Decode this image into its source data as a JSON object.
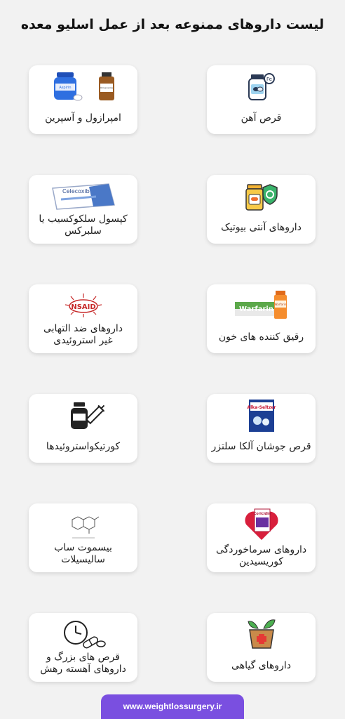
{
  "title": "لیست داروهای ممنوعه بعد از عمل اسلیو معده",
  "cards": [
    {
      "label": "قرص آهن",
      "icon": "iron-pill-bottle-icon"
    },
    {
      "label": "امپرازول و آسپرین",
      "icon": "medicine-bottles-icon",
      "texts": [
        "Aspirin",
        "Omeprazole"
      ]
    },
    {
      "label": "داروهای آنتی بیوتیک",
      "icon": "antibiotic-icon"
    },
    {
      "label": "کپسول سلکوکسیب یا\nسلبرکس",
      "icon": "celecoxib-box-icon",
      "texts": [
        "Celecoxib"
      ]
    },
    {
      "label": "رقیق کننده های خون",
      "icon": "warfarin-icon",
      "texts": [
        "Warfarin",
        "Warfarin"
      ]
    },
    {
      "label": "داروهای ضد التهابی\nغیر استروئیدی",
      "icon": "nsaid-icon",
      "texts": [
        "NSAID"
      ]
    },
    {
      "label": "قرص جوشان آلکا سلتزر",
      "icon": "alka-seltzer-icon",
      "texts": [
        "Alka-Seltzer"
      ]
    },
    {
      "label": "کورتیکواستروئیدها",
      "icon": "vial-syringe-icon"
    },
    {
      "label": "داروهای سرماخوردگی\nکوریسیدین",
      "icon": "coricidin-icon",
      "texts": [
        "Coricidin"
      ]
    },
    {
      "label": "بیسموت ساب\nسالیسیلات",
      "icon": "chemical-structure-icon"
    },
    {
      "label": "داروهای گیاهی",
      "icon": "herbal-mortar-icon"
    },
    {
      "label": "قرص های بزرگ و\nداروهای آهسته رهش",
      "icon": "clock-pills-icon"
    }
  ],
  "footer": "www.weightlossurgery.ir",
  "colors": {
    "background": "#f2f2f2",
    "footer": "#7a4fe0",
    "accent": "#ef6c2e"
  }
}
